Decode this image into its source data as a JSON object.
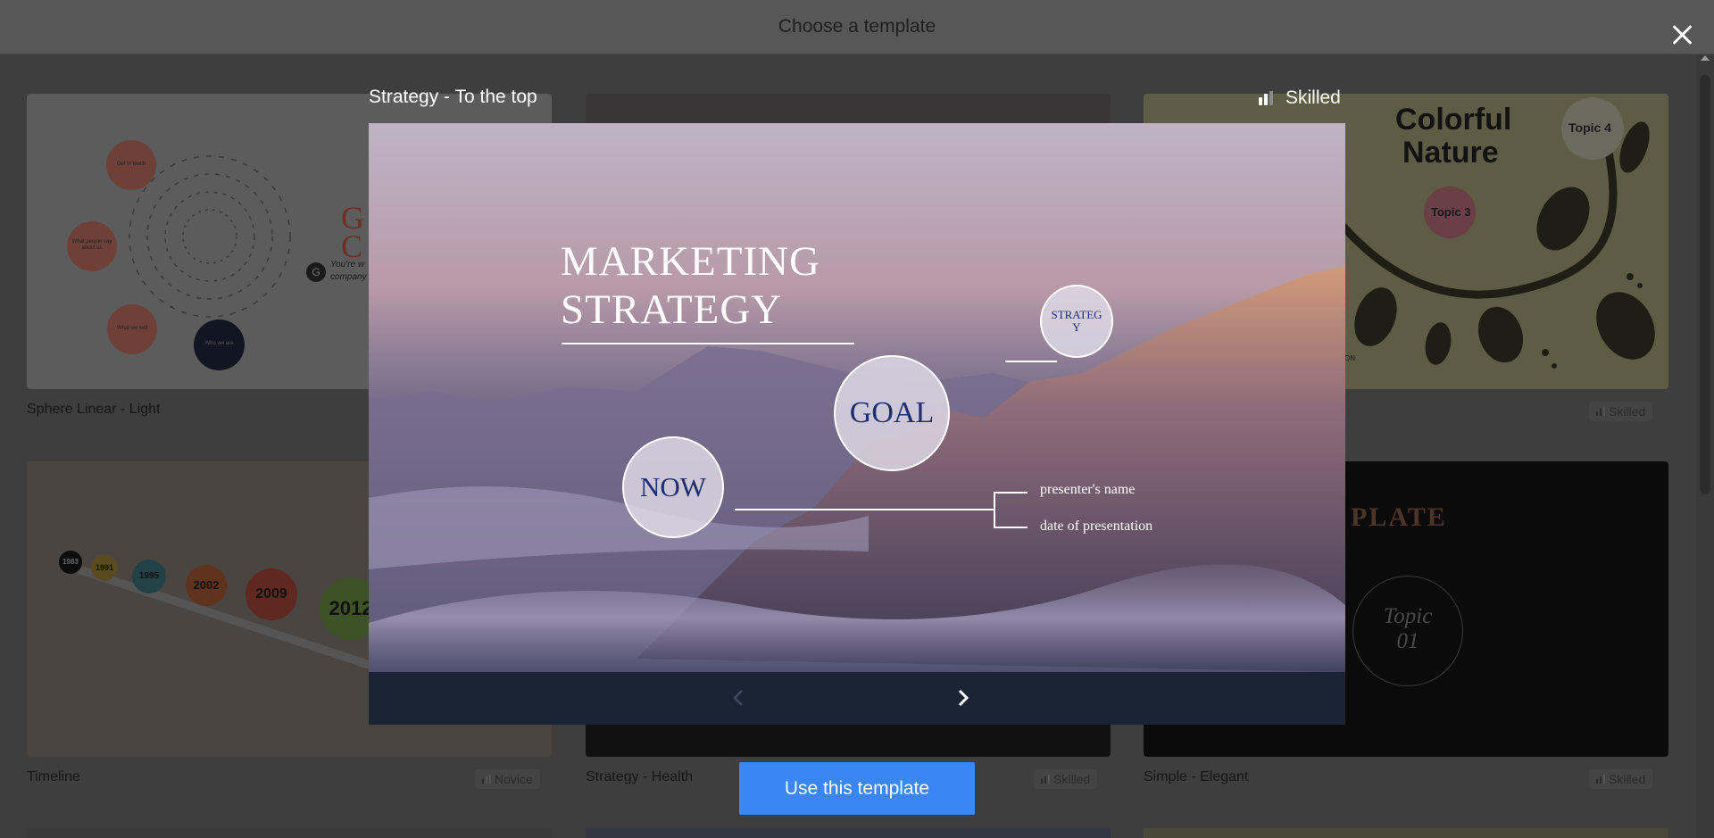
{
  "header": {
    "title": "Choose a template"
  },
  "templates": [
    {
      "name": "Sphere Linear - Light",
      "level": ""
    },
    {
      "name": "",
      "level": ""
    },
    {
      "name": "",
      "level": "Skilled"
    },
    {
      "name": "Timeline",
      "level": "Novice"
    },
    {
      "name": "Strategy - Health",
      "level": "Skilled"
    },
    {
      "name": "Simple - Elegant",
      "level": "Skilled"
    }
  ],
  "thumb_text": {
    "sphere": [
      "Get in touch",
      "What people say about us",
      "What we sell",
      "Who we are"
    ],
    "sphere_side": [
      "G",
      "C",
      "You're w",
      "company"
    ],
    "sphere_logo": "G",
    "colorful_title": [
      "Colorful",
      "Nature"
    ],
    "colorful_topics": [
      "Topic 4",
      "Topic 3"
    ],
    "colorful_fragment": "ON",
    "timeline_years": [
      "1983",
      "1991",
      "1995",
      "2002",
      "2009",
      "2012"
    ],
    "elegant_title": "PLATE",
    "elegant_topic": [
      "Topic",
      "01"
    ]
  },
  "modal": {
    "title": "Strategy - To the top",
    "level": "Skilled",
    "use_button": "Use this template"
  },
  "preview": {
    "title_lines": [
      "MARKETING",
      "STRATEGY"
    ],
    "strategy_circle": [
      "STRATEG",
      "Y"
    ],
    "goal": "GOAL",
    "now": "NOW",
    "presenter": "presenter's name",
    "date": "date of presentation"
  },
  "icons": {
    "close": "close-icon",
    "prev": "chevron-left-icon",
    "next": "chevron-right-icon",
    "level": "signal-bars-icon"
  },
  "colors": {
    "accent": "#3a86f5",
    "nav_bar": "#1b2435",
    "circle_text": "#1d2f6e"
  }
}
